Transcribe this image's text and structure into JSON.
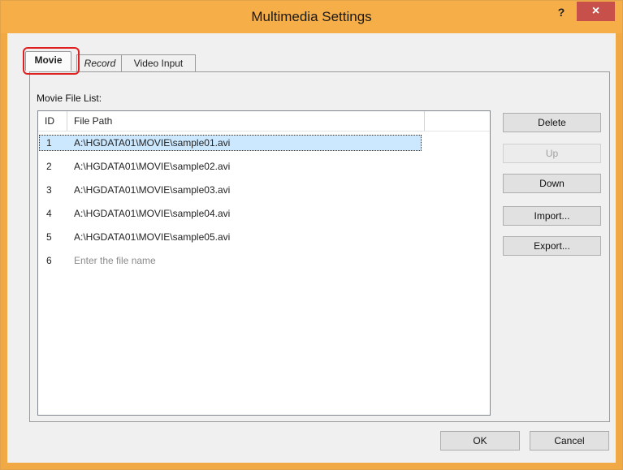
{
  "window": {
    "title": "Multimedia Settings",
    "help_label": "?",
    "close_label": "×"
  },
  "tabs": [
    {
      "label": "Movie",
      "selected": true
    },
    {
      "label": "Record",
      "selected": false
    },
    {
      "label": "Video Input",
      "selected": false
    }
  ],
  "movie": {
    "list_label": "Movie File List:",
    "columns": [
      "ID",
      "File Path"
    ],
    "rows": [
      {
        "id": "1",
        "path": "A:\\HGDATA01\\MOVIE\\sample01.avi",
        "selected": true
      },
      {
        "id": "2",
        "path": "A:\\HGDATA01\\MOVIE\\sample02.avi"
      },
      {
        "id": "3",
        "path": "A:\\HGDATA01\\MOVIE\\sample03.avi"
      },
      {
        "id": "4",
        "path": "A:\\HGDATA01\\MOVIE\\sample04.avi"
      },
      {
        "id": "5",
        "path": "A:\\HGDATA01\\MOVIE\\sample05.avi"
      },
      {
        "id": "6",
        "path": "Enter the file name",
        "placeholder": true
      }
    ],
    "buttons": {
      "delete": "Delete",
      "up": "Up",
      "down": "Down",
      "import": "Import...",
      "export": "Export..."
    }
  },
  "footer": {
    "ok": "OK",
    "cancel": "Cancel"
  },
  "colors": {
    "title_bar": "#f6ae48",
    "close": "#c7504b",
    "selection": "#cce8ff",
    "highlight": "#e02020"
  }
}
